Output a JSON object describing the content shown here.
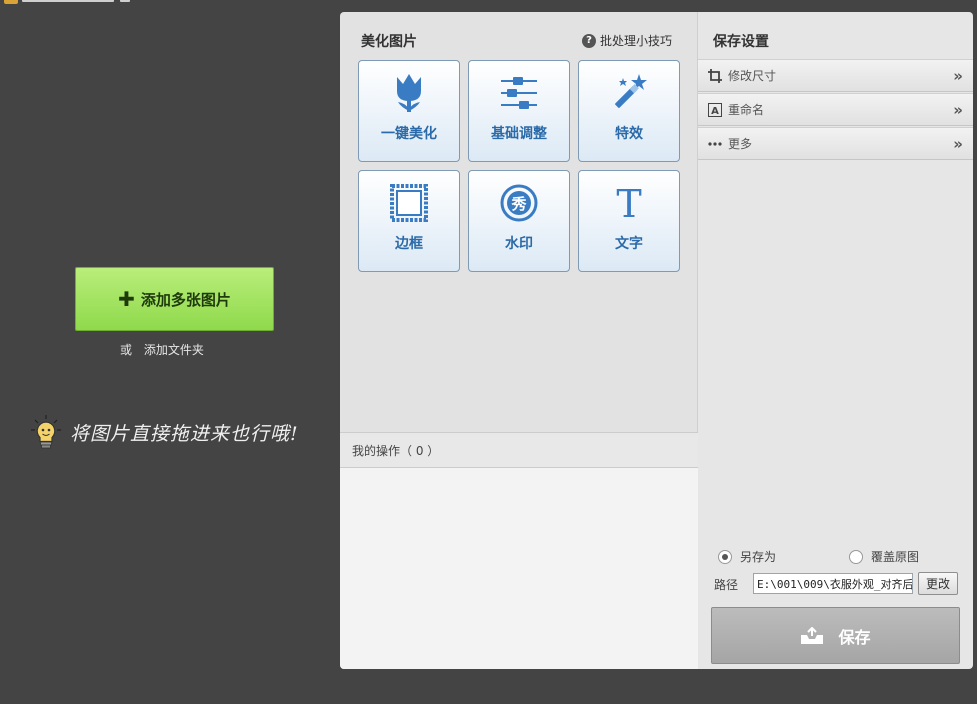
{
  "left": {
    "add_images_label": "添加多张图片",
    "or_text": "或",
    "add_folder_label": "添加文件夹",
    "drag_hint": "将图片直接拖进来也行哦!"
  },
  "center": {
    "title": "美化图片",
    "tips_label": "批处理小技巧",
    "tools": [
      {
        "label": "一键美化",
        "icon": "tulip-icon"
      },
      {
        "label": "基础调整",
        "icon": "sliders-icon"
      },
      {
        "label": "特效",
        "icon": "magic-wand-icon"
      },
      {
        "label": "边框",
        "icon": "frame-icon"
      },
      {
        "label": "水印",
        "icon": "watermark-seal-icon"
      },
      {
        "label": "文字",
        "icon": "text-icon"
      }
    ],
    "ops_label": "我的操作（ 0 ）"
  },
  "right": {
    "title": "保存设置",
    "sections": [
      {
        "label": "修改尺寸",
        "icon": "crop-icon"
      },
      {
        "label": "重命名",
        "icon": "rename-icon"
      },
      {
        "label": "更多",
        "icon": "more-icon"
      }
    ],
    "save_as_label": "另存为",
    "overwrite_label": "覆盖原图",
    "path_label": "路径",
    "path_value": "E:\\001\\009\\衣服外观_对齐后",
    "change_label": "更改",
    "save_label": "保存"
  },
  "colors": {
    "accent_blue": "#2b6aa8",
    "add_green": "#8fd94c",
    "background": "#444444"
  }
}
